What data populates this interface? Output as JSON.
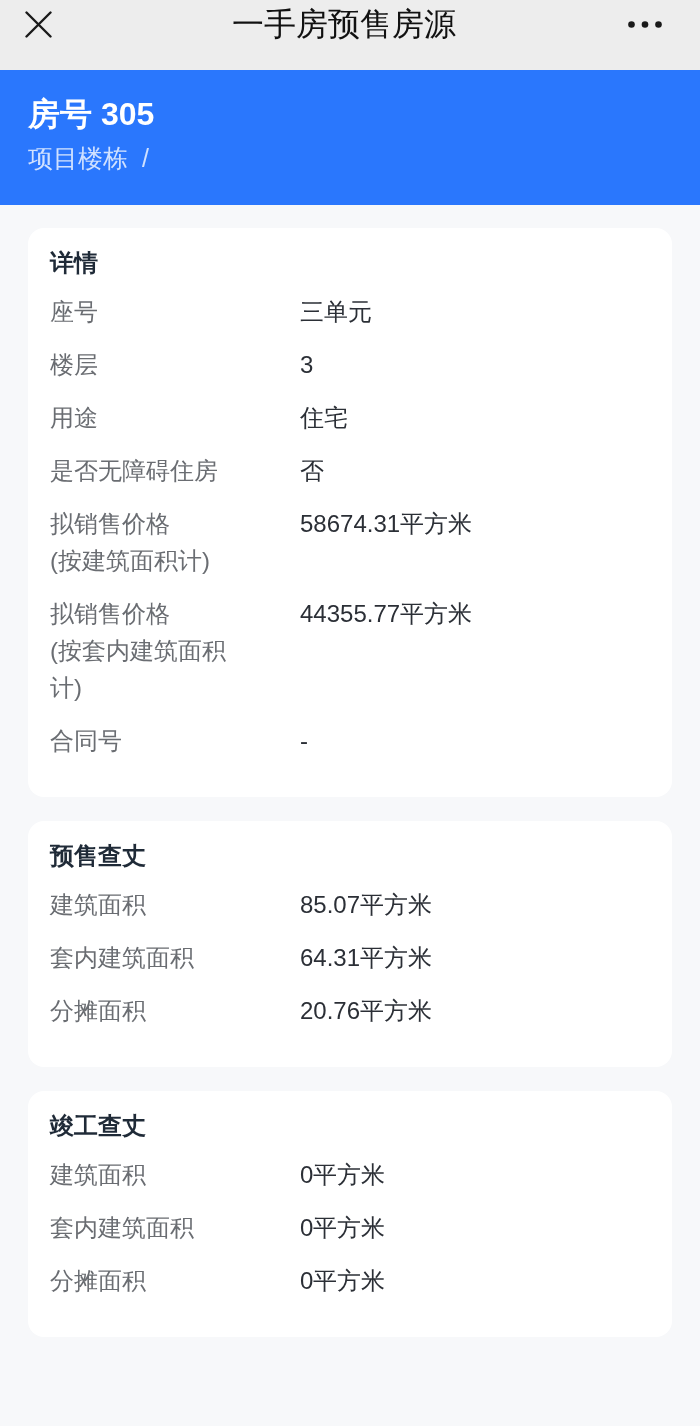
{
  "nav_bar": {
    "title": "一手房预售房源"
  },
  "header": {
    "title": "房号 305",
    "subtitle": "项目楼栋  /"
  },
  "sections": [
    {
      "title": "详情",
      "rows": [
        {
          "label": "座号",
          "value": "三单元"
        },
        {
          "label": "楼层",
          "value": "3"
        },
        {
          "label": "用途",
          "value": "住宅"
        },
        {
          "label": "是否无障碍住房",
          "value": "否"
        },
        {
          "label": "拟销售价格\n(按建筑面积计)",
          "value": "58674.31平方米"
        },
        {
          "label": "拟销售价格\n(按套内建筑面积计)",
          "value": "44355.77平方米"
        },
        {
          "label": "合同号",
          "value": "-"
        }
      ]
    },
    {
      "title": "预售查丈",
      "rows": [
        {
          "label": "建筑面积",
          "value": "85.07平方米"
        },
        {
          "label": "套内建筑面积",
          "value": "64.31平方米"
        },
        {
          "label": "分摊面积",
          "value": "20.76平方米"
        }
      ]
    },
    {
      "title": "竣工查丈",
      "rows": [
        {
          "label": "建筑面积",
          "value": "0平方米"
        },
        {
          "label": "套内建筑面积",
          "value": "0平方米"
        },
        {
          "label": "分摊面积",
          "value": "0平方米"
        }
      ]
    }
  ]
}
